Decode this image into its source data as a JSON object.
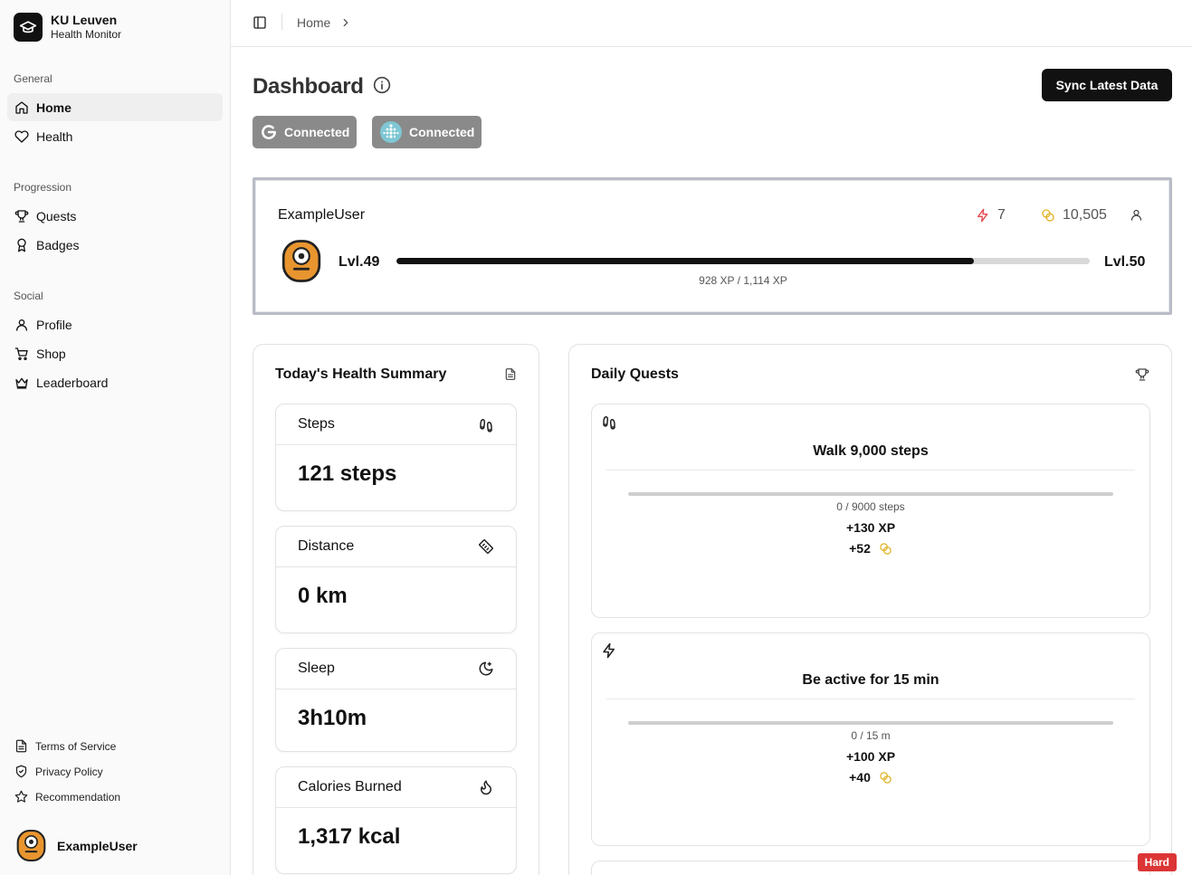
{
  "brand": {
    "title": "KU Leuven",
    "subtitle": "Health Monitor"
  },
  "sidebar": {
    "groups": [
      {
        "label": "General",
        "items": [
          {
            "label": "Home",
            "icon": "home-icon",
            "active": true
          },
          {
            "label": "Health",
            "icon": "heart-icon"
          }
        ]
      },
      {
        "label": "Progression",
        "items": [
          {
            "label": "Quests",
            "icon": "trophy-icon"
          },
          {
            "label": "Badges",
            "icon": "badge-icon"
          }
        ]
      },
      {
        "label": "Social",
        "items": [
          {
            "label": "Profile",
            "icon": "user-icon"
          },
          {
            "label": "Shop",
            "icon": "cart-icon"
          },
          {
            "label": "Leaderboard",
            "icon": "crown-icon"
          }
        ]
      }
    ],
    "footer": [
      {
        "label": "Terms of Service",
        "icon": "document-icon"
      },
      {
        "label": "Privacy Policy",
        "icon": "shield-icon"
      },
      {
        "label": "Recommendation",
        "icon": "star-icon"
      }
    ],
    "user": {
      "name": "ExampleUser"
    }
  },
  "topbar": {
    "breadcrumb": "Home"
  },
  "main": {
    "title": "Dashboard",
    "sync_label": "Sync Latest Data",
    "connections": [
      {
        "label": "Connected",
        "icon": "google-icon"
      },
      {
        "label": "Connected",
        "icon": "fitbit-icon"
      }
    ]
  },
  "player": {
    "name": "ExampleUser",
    "streak": "7",
    "coins": "10,505",
    "level_current": "Lvl.49",
    "level_next": "Lvl.50",
    "xp_text": "928 XP / 1,114 XP",
    "xp_fraction": 0.833
  },
  "health": {
    "title": "Today's Health Summary",
    "stats": [
      {
        "label": "Steps",
        "value": "121 steps",
        "icon": "footprints-icon"
      },
      {
        "label": "Distance",
        "value": "0 km",
        "icon": "ruler-icon"
      },
      {
        "label": "Sleep",
        "value": "3h10m",
        "icon": "moon-icon"
      },
      {
        "label": "Calories Burned",
        "value": "1,317 kcal",
        "icon": "flame-icon"
      }
    ]
  },
  "quests": {
    "title": "Daily Quests",
    "items": [
      {
        "title": "Walk 9,000 steps",
        "progress": "0 / 9000 steps",
        "progress_fraction": 0,
        "xp": "+130 XP",
        "coins": "+52",
        "icon": "footprints-icon"
      },
      {
        "title": "Be active for 15 min",
        "progress": "0 / 15 m",
        "progress_fraction": 0,
        "xp": "+100 XP",
        "coins": "+40",
        "icon": "zap-icon"
      }
    ],
    "difficulty_badge": "Hard"
  },
  "colors": {
    "accent": "#111111",
    "streak": "#e5484d",
    "coin": "#e0b224",
    "connected_bg": "#8a8a8a",
    "hard": "#dc3535",
    "avatar": "#e8952f"
  }
}
